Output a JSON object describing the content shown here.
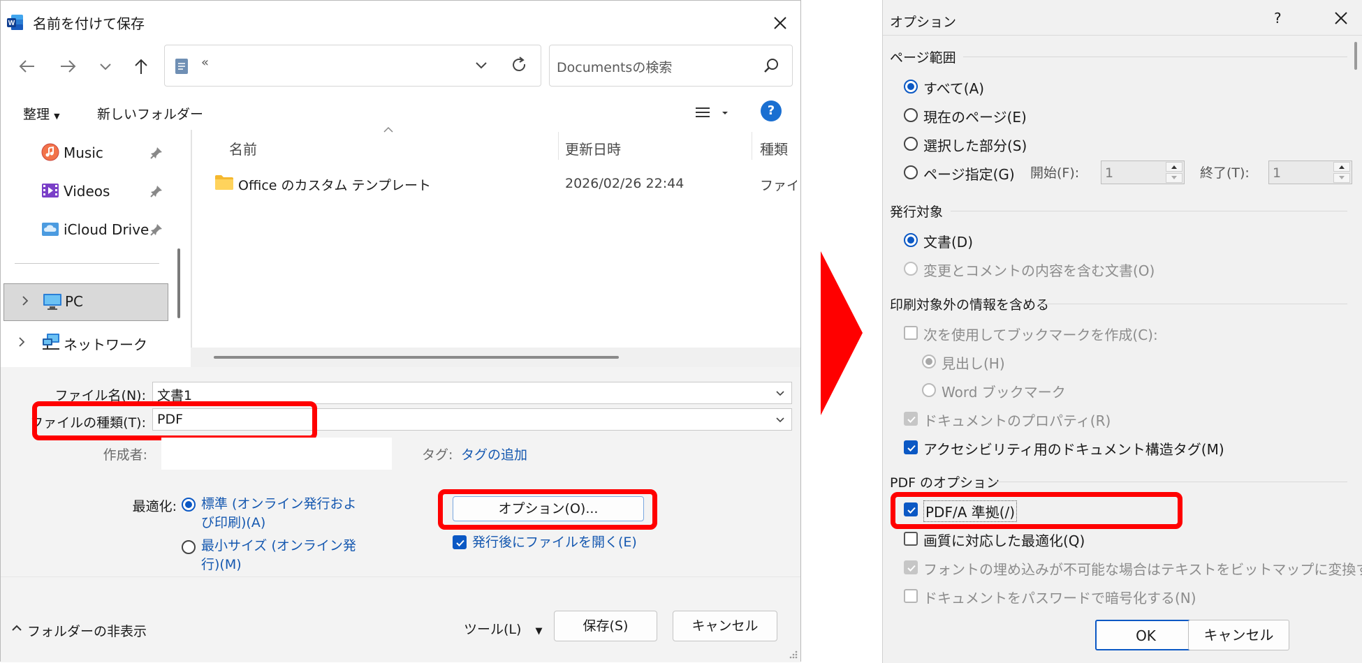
{
  "save_dialog": {
    "title": "名前を付けて保存",
    "address_text": "«",
    "search_placeholder": "Documentsの検索",
    "organize_label": "整理",
    "new_folder_label": "新しいフォルダー",
    "help_label": "?",
    "nav_items": [
      {
        "label": "Music",
        "icon": "music-icon",
        "pinned": true
      },
      {
        "label": "Videos",
        "icon": "videos-icon",
        "pinned": true
      },
      {
        "label": "iCloud Drive",
        "icon": "icloud-icon",
        "pinned": true
      },
      {
        "label": "PC",
        "icon": "pc-icon",
        "selected": true
      },
      {
        "label": "ネットワーク",
        "icon": "network-icon"
      }
    ],
    "columns": [
      "名前",
      "更新日時",
      "種類"
    ],
    "files": [
      {
        "name": "Office のカスタム テンプレート",
        "modified": "2026/02/26 22:44",
        "type": "ファイル"
      }
    ],
    "filename_label": "ファイル名(N):",
    "filename_value": "文書1",
    "filetype_label": "ファイルの種類(T):",
    "filetype_value": "PDF",
    "author_label": "作成者:",
    "tags_label": "タグ:",
    "tags_link": "タグの追加",
    "optimize_label": "最適化:",
    "optimize_standard_line1": "標準 (オンライン発行およ",
    "optimize_standard_line2": "び印刷)(A)",
    "optimize_min_line1": "最小サイズ (オンライン発",
    "optimize_min_line2": "行)(M)",
    "optimize_selected": "standard",
    "options_button": "オプション(O)...",
    "open_after_label": "発行後にファイルを開く(E)",
    "open_after_checked": true,
    "hide_folders_label": "フォルダーの非表示",
    "tools_label": "ツール(L)",
    "save_button": "保存(S)",
    "cancel_button": "キャンセル"
  },
  "options_dialog": {
    "title": "オプション",
    "help_label": "?",
    "page_range_header": "ページ範囲",
    "page_range_options": [
      "すべて(A)",
      "現在のページ(E)",
      "選択した部分(S)",
      "ページ指定(G)"
    ],
    "page_range_selected": 0,
    "start_label": "開始(F):",
    "start_value": "1",
    "end_label": "終了(T):",
    "end_value": "1",
    "publish_header": "発行対象",
    "publish_options": [
      "文書(D)",
      "変更とコメントの内容を含む文書(O)"
    ],
    "publish_selected": 0,
    "nonprint_header": "印刷対象外の情報を含める",
    "bookmark_label": "次を使用してブックマークを作成(C):",
    "bookmark_checked": false,
    "headings_label": "見出し(H)",
    "word_bookmarks_label": "Word ブックマーク",
    "doc_props_label": "ドキュメントのプロパティ(R)",
    "doc_props_checked": true,
    "struct_tags_label": "アクセシビリティ用のドキュメント構造タグ(M)",
    "struct_tags_checked": true,
    "pdf_options_header": "PDF のオプション",
    "pdfa_label": "PDF/A 準拠(/)",
    "pdfa_checked": true,
    "optimize_quality_label": "画質に対応した最適化(Q)",
    "optimize_quality_checked": false,
    "bitmap_text_label": "フォントの埋め込みが不可能な場合はテキストをビットマップに変換する(X)",
    "bitmap_text_checked": true,
    "encrypt_label": "ドキュメントをパスワードで暗号化する(N)",
    "encrypt_checked": false,
    "ok_button": "OK",
    "cancel_button": "キャンセル"
  },
  "colors": {
    "highlight_red": "#ff0000",
    "accent_blue": "#0b58c4",
    "link_blue": "#1558b0"
  }
}
